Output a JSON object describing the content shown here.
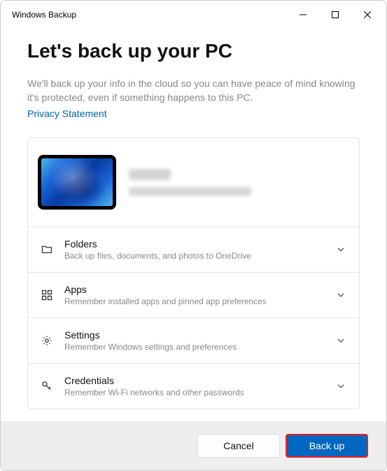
{
  "window": {
    "title": "Windows Backup"
  },
  "page": {
    "heading": "Let's back up your PC",
    "description": "We'll back up your info in the cloud so you can have peace of mind knowing it's protected, even if something happens to this PC.",
    "privacy_link": "Privacy Statement"
  },
  "categories": [
    {
      "title": "Folders",
      "subtitle": "Back up files, documents, and photos to OneDrive"
    },
    {
      "title": "Apps",
      "subtitle": "Remember installed apps and pinned app preferences"
    },
    {
      "title": "Settings",
      "subtitle": "Remember Windows settings and preferences"
    },
    {
      "title": "Credentials",
      "subtitle": "Remember Wi-Fi networks and other passwords"
    }
  ],
  "footer": {
    "cancel": "Cancel",
    "backup": "Back up"
  }
}
